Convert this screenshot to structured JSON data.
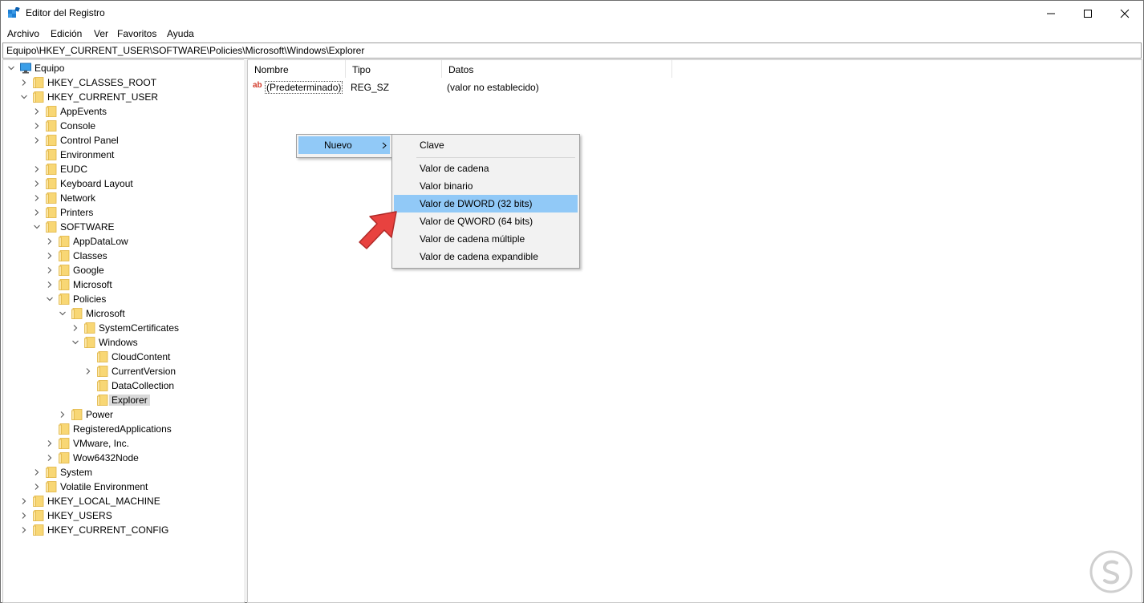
{
  "window": {
    "title": "Editor del Registro",
    "controls": {
      "minimize": "minimize-icon",
      "maximize": "maximize-icon",
      "close": "close-icon"
    }
  },
  "menubar": [
    "Archivo",
    "Edición",
    "Ver",
    "Favoritos",
    "Ayuda"
  ],
  "address": "Equipo\\HKEY_CURRENT_USER\\SOFTWARE\\Policies\\Microsoft\\Windows\\Explorer",
  "tree": [
    {
      "label": "Equipo",
      "depth": 0,
      "expander": "open",
      "icon": "computer-icon"
    },
    {
      "label": "HKEY_CLASSES_ROOT",
      "depth": 1,
      "expander": "closed"
    },
    {
      "label": "HKEY_CURRENT_USER",
      "depth": 1,
      "expander": "open"
    },
    {
      "label": "AppEvents",
      "depth": 2,
      "expander": "closed"
    },
    {
      "label": "Console",
      "depth": 2,
      "expander": "closed"
    },
    {
      "label": "Control Panel",
      "depth": 2,
      "expander": "closed"
    },
    {
      "label": "Environment",
      "depth": 2,
      "expander": "none"
    },
    {
      "label": "EUDC",
      "depth": 2,
      "expander": "closed"
    },
    {
      "label": "Keyboard Layout",
      "depth": 2,
      "expander": "closed"
    },
    {
      "label": "Network",
      "depth": 2,
      "expander": "closed"
    },
    {
      "label": "Printers",
      "depth": 2,
      "expander": "closed"
    },
    {
      "label": "SOFTWARE",
      "depth": 2,
      "expander": "open"
    },
    {
      "label": "AppDataLow",
      "depth": 3,
      "expander": "closed"
    },
    {
      "label": "Classes",
      "depth": 3,
      "expander": "closed"
    },
    {
      "label": "Google",
      "depth": 3,
      "expander": "closed"
    },
    {
      "label": "Microsoft",
      "depth": 3,
      "expander": "closed"
    },
    {
      "label": "Policies",
      "depth": 3,
      "expander": "open"
    },
    {
      "label": "Microsoft",
      "depth": 4,
      "expander": "open"
    },
    {
      "label": "SystemCertificates",
      "depth": 5,
      "expander": "closed"
    },
    {
      "label": "Windows",
      "depth": 5,
      "expander": "open"
    },
    {
      "label": "CloudContent",
      "depth": 6,
      "expander": "none"
    },
    {
      "label": "CurrentVersion",
      "depth": 6,
      "expander": "closed"
    },
    {
      "label": "DataCollection",
      "depth": 6,
      "expander": "none"
    },
    {
      "label": "Explorer",
      "depth": 6,
      "expander": "none",
      "selected": true
    },
    {
      "label": "Power",
      "depth": 4,
      "expander": "closed"
    },
    {
      "label": "RegisteredApplications",
      "depth": 3,
      "expander": "none"
    },
    {
      "label": "VMware, Inc.",
      "depth": 3,
      "expander": "closed"
    },
    {
      "label": "Wow6432Node",
      "depth": 3,
      "expander": "closed"
    },
    {
      "label": "System",
      "depth": 2,
      "expander": "closed"
    },
    {
      "label": "Volatile Environment",
      "depth": 2,
      "expander": "closed"
    },
    {
      "label": "HKEY_LOCAL_MACHINE",
      "depth": 1,
      "expander": "closed"
    },
    {
      "label": "HKEY_USERS",
      "depth": 1,
      "expander": "closed"
    },
    {
      "label": "HKEY_CURRENT_CONFIG",
      "depth": 1,
      "expander": "closed"
    }
  ],
  "list": {
    "headers": [
      "Nombre",
      "Tipo",
      "Datos"
    ],
    "rows": [
      {
        "icon": "ab",
        "name": "(Predeterminado)",
        "type": "REG_SZ",
        "data": "(valor no establecido)"
      }
    ]
  },
  "context_menu": {
    "item": "Nuevo",
    "submenu": [
      "Clave",
      "Valor de cadena",
      "Valor binario",
      "Valor de DWORD (32 bits)",
      "Valor de QWORD (64 bits)",
      "Valor de cadena múltiple",
      "Valor de cadena expandible"
    ],
    "highlighted": "Valor de DWORD (32 bits)"
  },
  "colors": {
    "highlight": "#91c9f7",
    "selected": "#d9d9d9",
    "folder": "#f8d775",
    "folder_edge": "#e0b440",
    "arrow": "#e8423f"
  }
}
